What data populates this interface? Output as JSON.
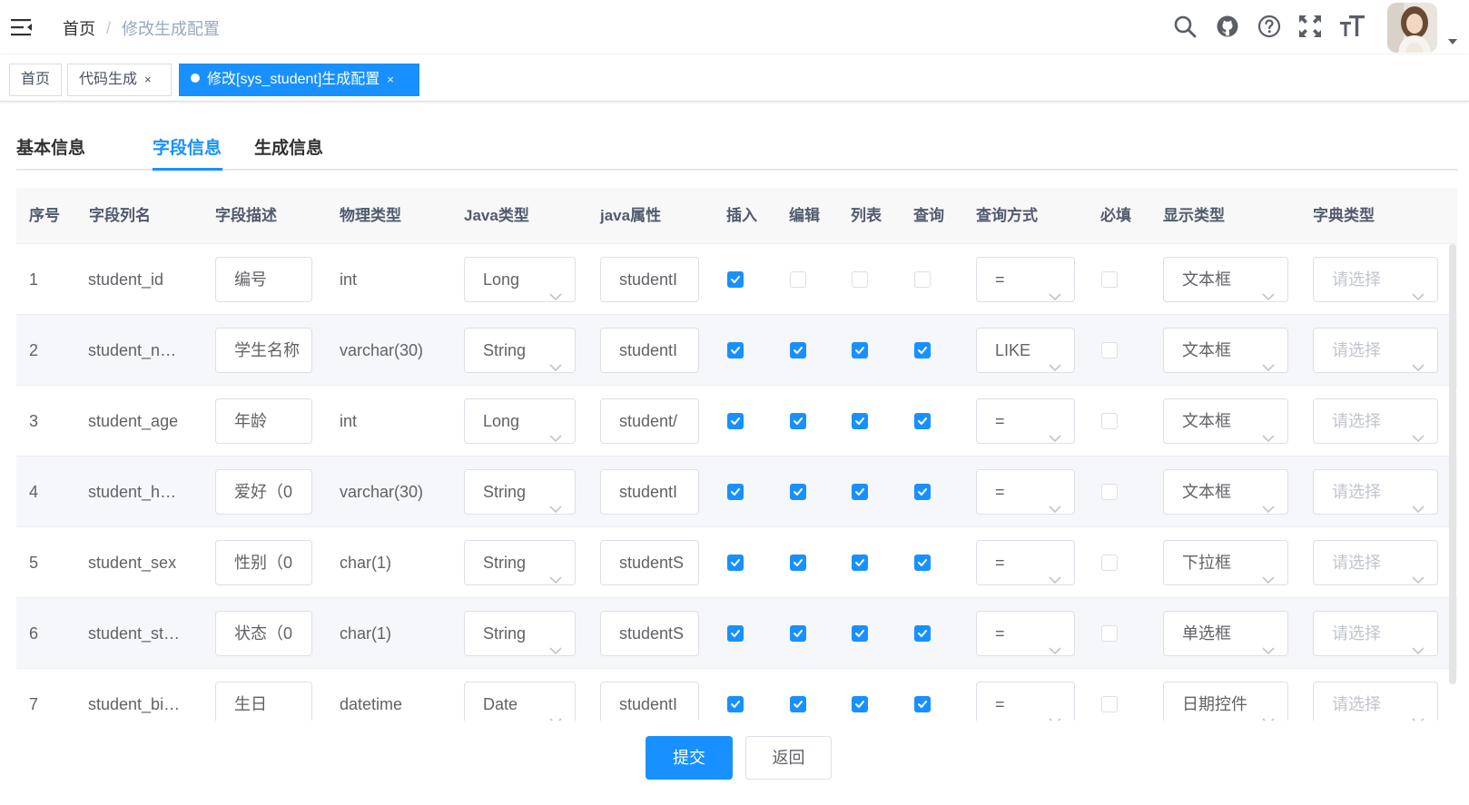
{
  "navbar": {
    "breadcrumb": {
      "home": "首页",
      "separator": "/",
      "current": "修改生成配置"
    },
    "icons": [
      "search-icon",
      "github-icon",
      "help-icon",
      "fullscreen-icon",
      "font-size-icon"
    ]
  },
  "tags": [
    {
      "label": "首页",
      "close": ""
    },
    {
      "label": "代码生成",
      "close": "×"
    },
    {
      "label": "修改[sys_student]生成配置",
      "close": "×"
    }
  ],
  "tabs": [
    {
      "label": "基本信息",
      "active": false
    },
    {
      "label": "字段信息",
      "active": true
    },
    {
      "label": "生成信息",
      "active": false
    }
  ],
  "columns": [
    "序号",
    "字段列名",
    "字段描述",
    "物理类型",
    "Java类型",
    "java属性",
    "插入",
    "编辑",
    "列表",
    "查询",
    "查询方式",
    "必填",
    "显示类型",
    "字典类型"
  ],
  "rows": [
    {
      "index": "1",
      "column": "student_id",
      "desc": "编号",
      "phys": "int",
      "java_type": "Long",
      "java_attr": "studentI",
      "insert": true,
      "edit": false,
      "list": false,
      "query": false,
      "query_type": "=",
      "required": false,
      "html_type": "文本框",
      "dict_type": "请选择"
    },
    {
      "index": "2",
      "column": "student_n…",
      "desc": "学生名称",
      "phys": "varchar(30)",
      "java_type": "String",
      "java_attr": "studentI",
      "insert": true,
      "edit": true,
      "list": true,
      "query": true,
      "query_type": "LIKE",
      "required": false,
      "html_type": "文本框",
      "dict_type": "请选择"
    },
    {
      "index": "3",
      "column": "student_age",
      "desc": "年龄",
      "phys": "int",
      "java_type": "Long",
      "java_attr": "student/",
      "insert": true,
      "edit": true,
      "list": true,
      "query": true,
      "query_type": "=",
      "required": false,
      "html_type": "文本框",
      "dict_type": "请选择"
    },
    {
      "index": "4",
      "column": "student_h…",
      "desc": "爱好（0",
      "phys": "varchar(30)",
      "java_type": "String",
      "java_attr": "studentI",
      "insert": true,
      "edit": true,
      "list": true,
      "query": true,
      "query_type": "=",
      "required": false,
      "html_type": "文本框",
      "dict_type": "请选择"
    },
    {
      "index": "5",
      "column": "student_sex",
      "desc": "性别（0",
      "phys": "char(1)",
      "java_type": "String",
      "java_attr": "studentS",
      "insert": true,
      "edit": true,
      "list": true,
      "query": true,
      "query_type": "=",
      "required": false,
      "html_type": "下拉框",
      "dict_type": "请选择"
    },
    {
      "index": "6",
      "column": "student_st…",
      "desc": "状态（0",
      "phys": "char(1)",
      "java_type": "String",
      "java_attr": "studentS",
      "insert": true,
      "edit": true,
      "list": true,
      "query": true,
      "query_type": "=",
      "required": false,
      "html_type": "单选框",
      "dict_type": "请选择"
    },
    {
      "index": "7",
      "column": "student_bi…",
      "desc": "生日",
      "phys": "datetime",
      "java_type": "Date",
      "java_attr": "studentI",
      "insert": true,
      "edit": true,
      "list": true,
      "query": true,
      "query_type": "=",
      "required": false,
      "html_type": "日期控件",
      "dict_type": "请选择"
    }
  ],
  "buttons": {
    "submit": "提交",
    "back": "返回"
  },
  "colors": {
    "primary": "#1890ff",
    "border": "#dcdfe6",
    "header_bg": "#f8f8f9",
    "stripe_bg": "#f5f7fa"
  }
}
